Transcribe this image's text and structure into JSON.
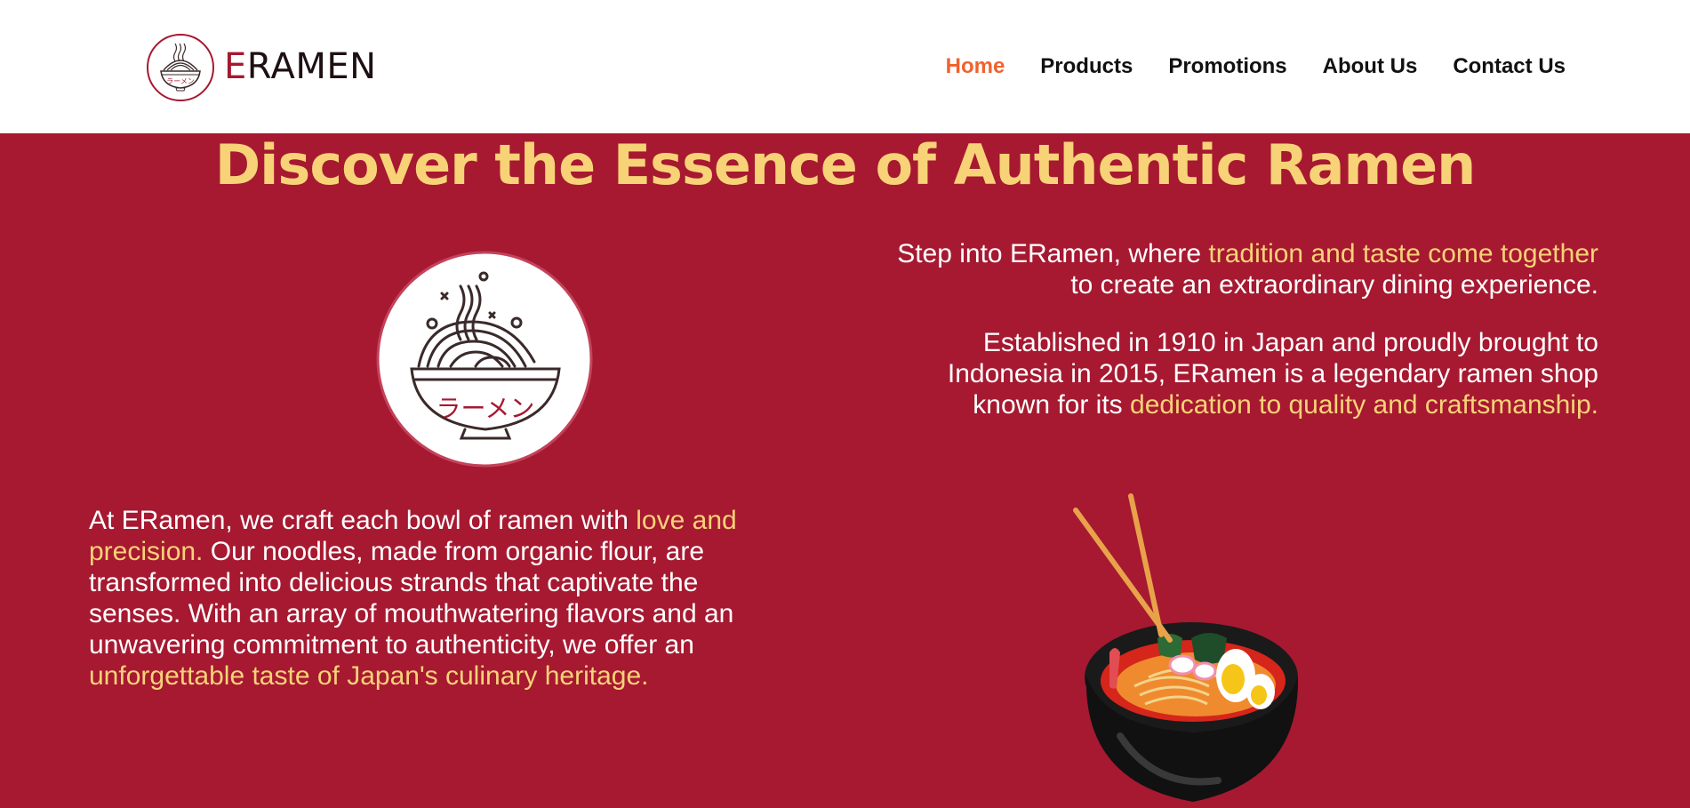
{
  "header": {
    "logo_icon": "ramen-bowl-logo-icon",
    "brand_first": "E",
    "brand_rest": "RAMEN",
    "nav": [
      {
        "label": "Home",
        "active": true
      },
      {
        "label": "Products",
        "active": false
      },
      {
        "label": "Promotions",
        "active": false
      },
      {
        "label": "About Us",
        "active": false
      },
      {
        "label": "Contact Us",
        "active": false
      }
    ]
  },
  "hero": {
    "title": "Discover the Essence of Authentic Ramen",
    "right_para1": {
      "a": "Step into ERamen, where ",
      "hl": "tradition and taste come together",
      "b": " to create an extraordinary dining experience."
    },
    "right_para2": {
      "a": "Established in 1910 in Japan and proudly brought to Indonesia in 2015, ERamen is a legendary ramen shop known for its ",
      "hl": "dedication to quality and craftsmanship."
    },
    "left_para": {
      "a": "At ERamen, we craft each bowl of ramen with ",
      "hl1": "love and precision.",
      "b": " Our noodles, made from organic flour, are transformed into delicious strands that captivate the senses. With an array of mouthwatering flavors and an unwavering commitment to authenticity, we offer an ",
      "hl2": "unforgettable taste of Japan's culinary heritage."
    },
    "emblem_text": "ラーメン",
    "emblem_icon": "ramen-emblem-icon",
    "illustration": "ramen-bowl-with-chopsticks-illustration"
  },
  "colors": {
    "primary": "#a61931",
    "accent_yellow": "#f8d277",
    "nav_active": "#f0622f",
    "text_dark": "#111111",
    "white": "#ffffff"
  }
}
